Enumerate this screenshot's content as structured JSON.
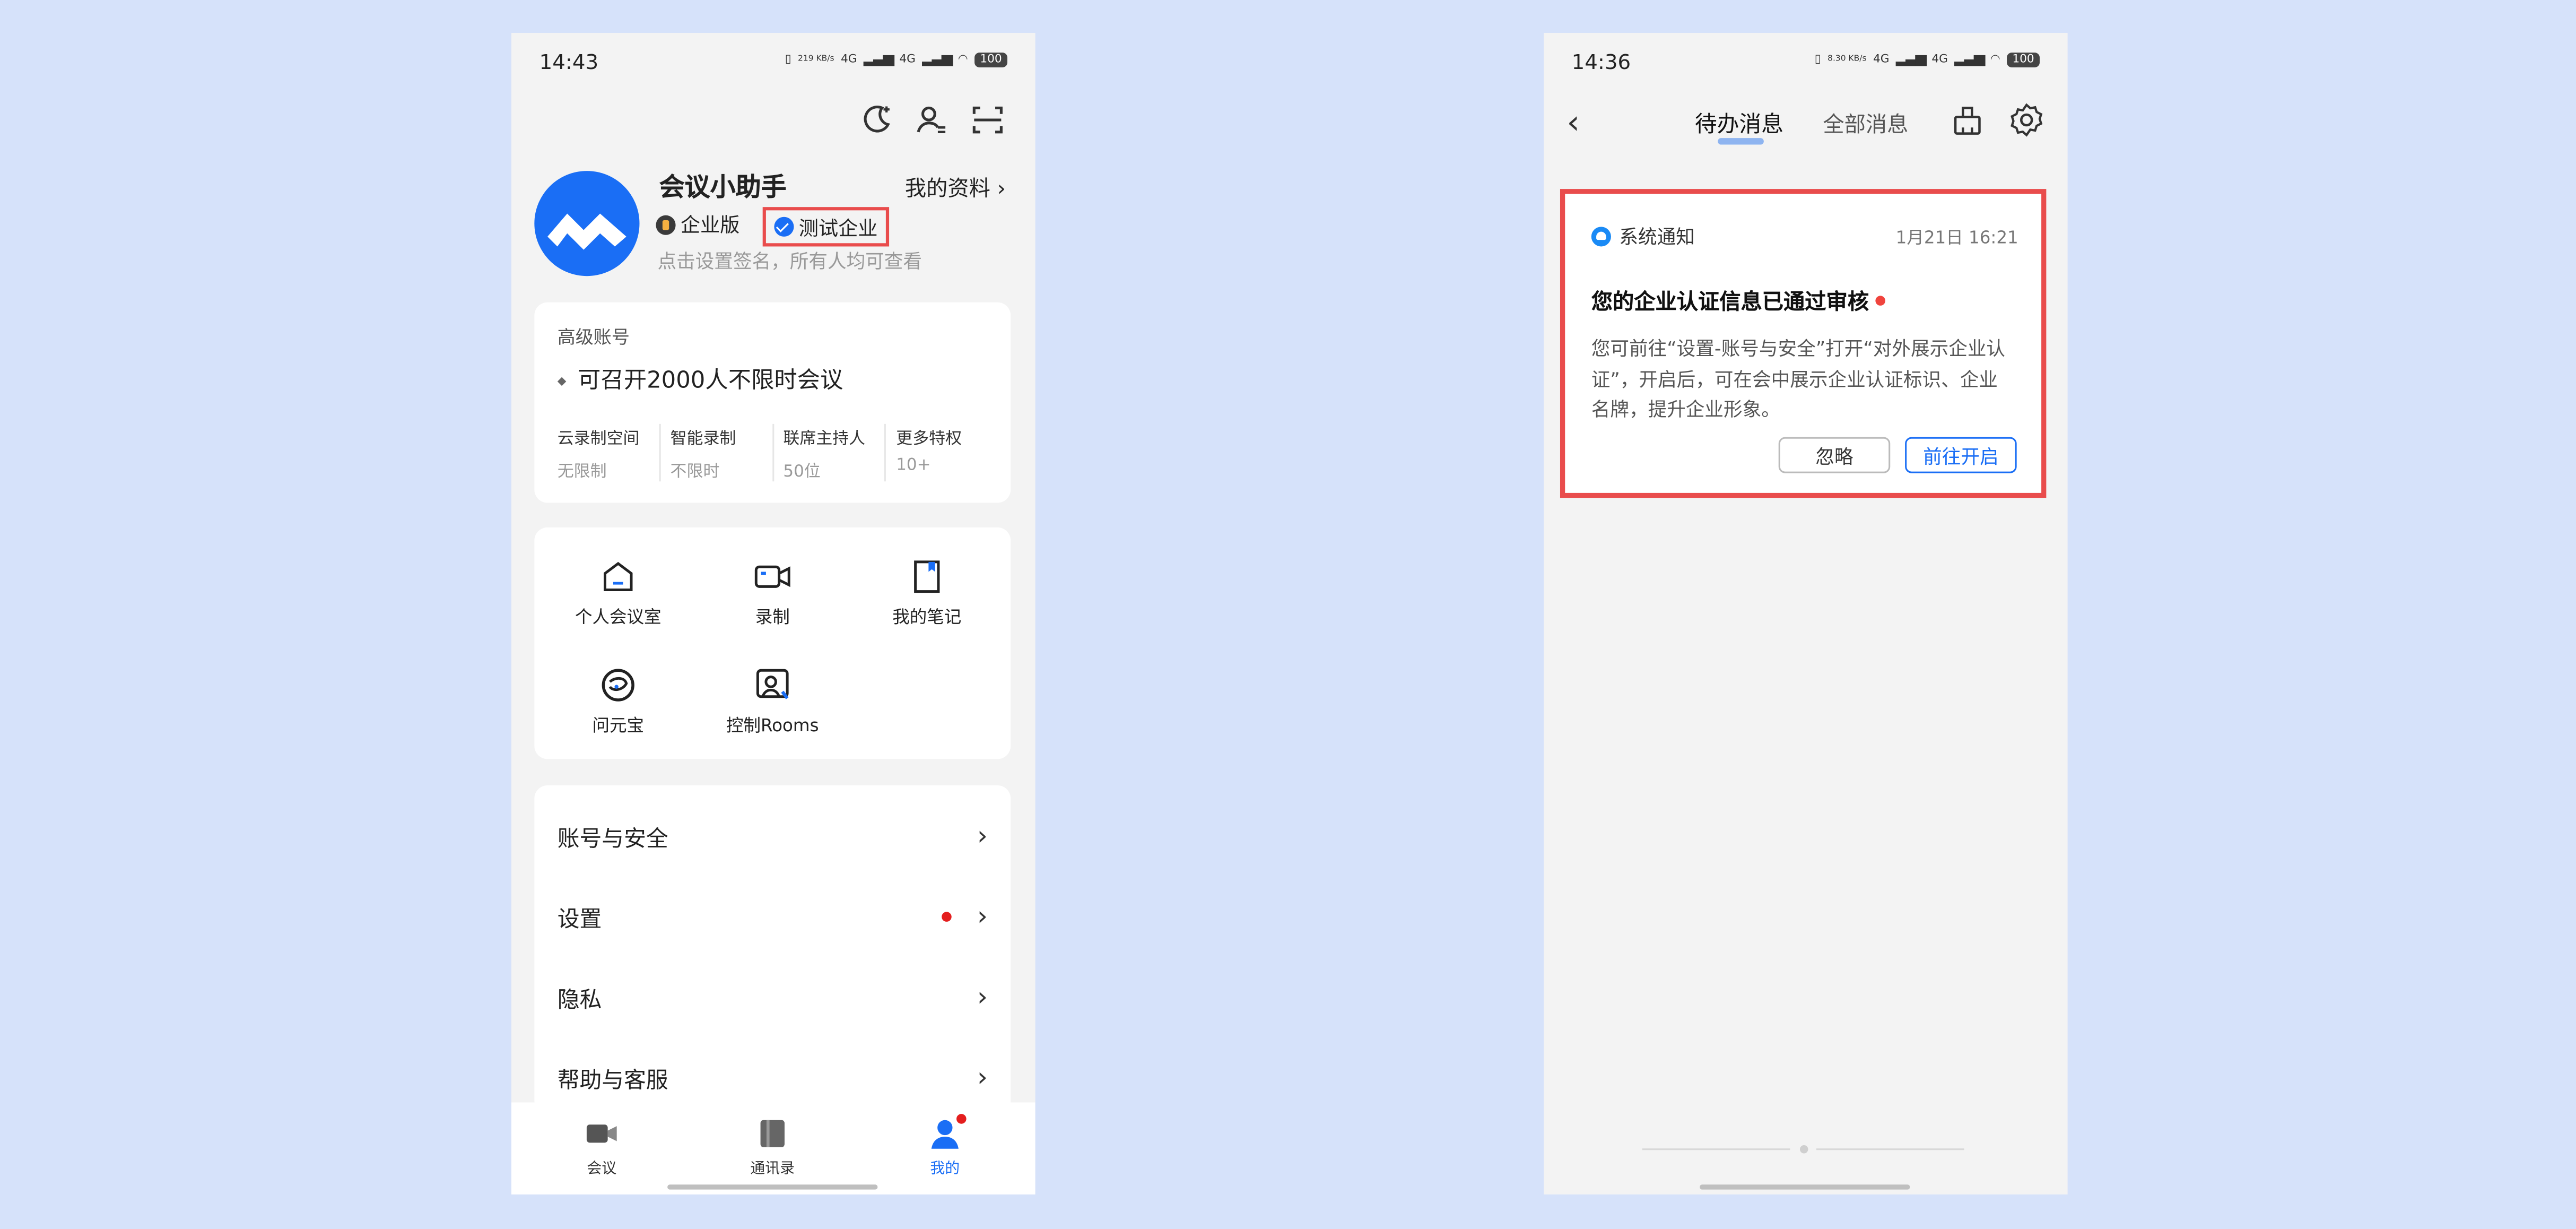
{
  "left": {
    "status": {
      "time": "14:43",
      "net_speed": "219 KB/s",
      "net_type": "4G",
      "battery": "100"
    },
    "profile": {
      "name": "会议小助手",
      "profile_link": "我的资料",
      "edition": "企业版",
      "company": "测试企业",
      "signature_hint": "点击设置签名，所有人均可查看"
    },
    "vip": {
      "title": "高级账号",
      "headline": "可召开2000人不限时会议",
      "perks": [
        {
          "label": "云录制空间",
          "value": "无限制"
        },
        {
          "label": "智能录制",
          "value": "不限时"
        },
        {
          "label": "联席主持人",
          "value": "50位"
        },
        {
          "label": "更多特权",
          "value": "10+"
        }
      ]
    },
    "features": [
      "个人会议室",
      "录制",
      "我的笔记",
      "问元宝",
      "控制Rooms"
    ],
    "menu": [
      "账号与安全",
      "设置",
      "隐私",
      "帮助与客服"
    ],
    "tabs": [
      "会议",
      "通讯录",
      "我的"
    ]
  },
  "right": {
    "status": {
      "time": "14:36",
      "net_speed": "8.30 KB/s",
      "net_type": "4G",
      "battery": "100"
    },
    "tabs": {
      "todo": "待办消息",
      "all": "全部消息"
    },
    "notice": {
      "source": "系统通知",
      "date": "1月21日 16:21",
      "title": "您的企业认证信息已通过审核",
      "body": "您可前往“设置-账号与安全”打开“对外展示企业认证”，开启后，可在会中展示企业认证标识、企业名牌，提升企业形象。",
      "ignore": "忽略",
      "go": "前往开启"
    }
  },
  "colors": {
    "accent": "#1a6ef5",
    "highlight_border": "#e94c4c",
    "badge_red": "#e41e1e",
    "background": "#d6e2fa"
  }
}
